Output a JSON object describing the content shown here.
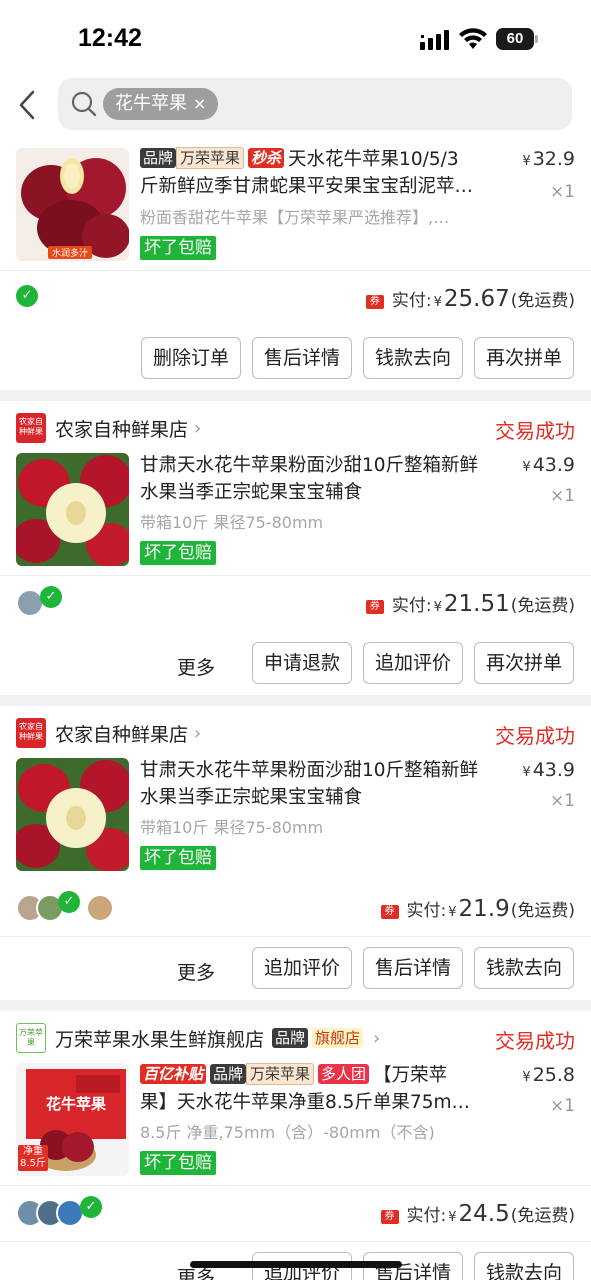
{
  "status_bar": {
    "time": "12:42",
    "battery": "60"
  },
  "search": {
    "query": "花牛苹果",
    "clear": "×"
  },
  "orders": [
    {
      "title_tags": [
        "品牌",
        "万荣苹果",
        "秒杀"
      ],
      "title_line1": "天水花牛苹果10/5/3",
      "title_line2": "斤新鲜应季甘肃蛇果平安果宝宝刮泥苹…",
      "spec": "粉面香甜花牛苹果【万荣苹果严选推荐】,…",
      "img_label": "水润多汁",
      "guarantee": "坏了包赔",
      "price_yen": "¥",
      "price": "32.9",
      "qty": "×1",
      "coupon": "券",
      "paid_label": "实付:",
      "paid_yen": "¥",
      "paid_amount": "25.67",
      "shipping": "(免运费)",
      "buttons": [
        "删除订单",
        "售后详情",
        "钱款去向",
        "再次拼单"
      ]
    },
    {
      "shop_logo": "农家自种鲜果",
      "shop_name": "农家自种鲜果店",
      "status": "交易成功",
      "title_line1": "甘肃天水花牛苹果粉面沙甜10斤整箱新鲜",
      "title_line2": "水果当季正宗蛇果宝宝辅食",
      "spec": "带箱10斤 果径75-80mm",
      "guarantee": "坏了包赔",
      "price_yen": "¥",
      "price": "43.9",
      "qty": "×1",
      "coupon": "券",
      "paid_label": "实付:",
      "paid_yen": "¥",
      "paid_amount": "21.51",
      "shipping": "(免运费)",
      "more": "更多",
      "buttons": [
        "申请退款",
        "追加评价",
        "再次拼单"
      ]
    },
    {
      "shop_logo": "农家自种鲜果",
      "shop_name": "农家自种鲜果店",
      "status": "交易成功",
      "title_line1": "甘肃天水花牛苹果粉面沙甜10斤整箱新鲜",
      "title_line2": "水果当季正宗蛇果宝宝辅食",
      "spec": "带箱10斤 果径75-80mm",
      "guarantee": "坏了包赔",
      "price_yen": "¥",
      "price": "43.9",
      "qty": "×1",
      "coupon": "券",
      "paid_label": "实付:",
      "paid_yen": "¥",
      "paid_amount": "21.9",
      "shipping": "(免运费)",
      "more": "更多",
      "buttons": [
        "追加评价",
        "售后详情",
        "钱款去向"
      ]
    },
    {
      "shop_logo": "万荣苹果",
      "shop_name": "万荣苹果水果生鲜旗舰店",
      "shop_tags": [
        "品牌",
        "旗舰店"
      ],
      "status": "交易成功",
      "title_tags": [
        "百亿补贴",
        "品牌",
        "万荣苹果",
        "多人团"
      ],
      "title_line1": "【万荣苹",
      "title_line2": "果】天水花牛苹果净重8.5斤单果75m…",
      "spec": "8.5斤 净重,75mm（含）-80mm（不含)",
      "img_label_top": "花牛苹果",
      "img_label_bottom": "净重8.5斤",
      "guarantee": "坏了包赔",
      "price_yen": "¥",
      "price": "25.8",
      "qty": "×1",
      "coupon": "券",
      "paid_label": "实付:",
      "paid_yen": "¥",
      "paid_amount": "24.5",
      "shipping": "(免运费)",
      "more": "更多",
      "buttons": [
        "追加评价",
        "售后详情",
        "钱款去向"
      ]
    }
  ],
  "colors": {
    "accent_red": "#e02e24",
    "guarantee_green": "#1fb539",
    "background": "#f2f2f2"
  }
}
